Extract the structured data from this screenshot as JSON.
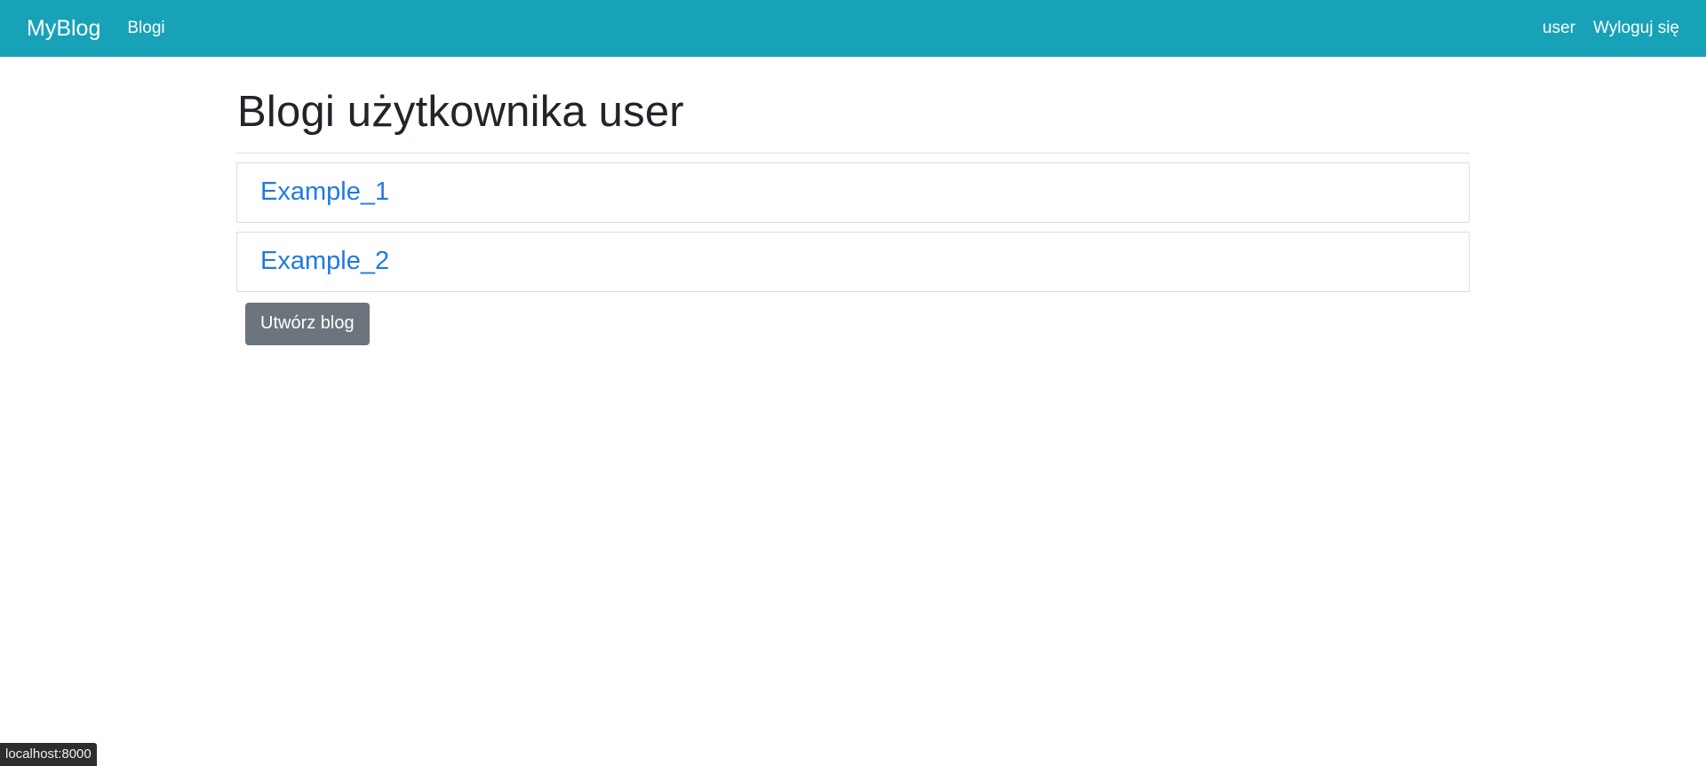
{
  "navbar": {
    "brand": "MyBlog",
    "links": [
      {
        "label": "Blogi"
      }
    ],
    "user_label": "user",
    "logout_label": "Wyloguj się",
    "background_color": "#17a2b8"
  },
  "main": {
    "title": "Blogi użytkownika user",
    "blogs": [
      {
        "title": "Example_1"
      },
      {
        "title": "Example_2"
      }
    ],
    "create_button_label": "Utwórz blog",
    "link_color": "#1f7ae0",
    "button_color": "#6c757d"
  },
  "status_bar": {
    "url": "localhost:8000"
  }
}
